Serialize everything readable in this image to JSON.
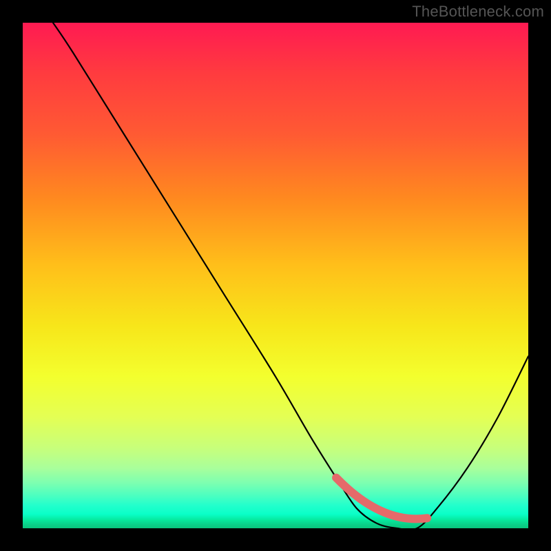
{
  "attribution": "TheBottleneck.com",
  "chart_data": {
    "type": "line",
    "title": "",
    "xlabel": "",
    "ylabel": "",
    "xlim": [
      0,
      100
    ],
    "ylim": [
      0,
      100
    ],
    "series": [
      {
        "name": "bottleneck-curve",
        "x": [
          6,
          10,
          20,
          30,
          40,
          50,
          57,
          62,
          66,
          70,
          74,
          78,
          82,
          88,
          94,
          100
        ],
        "values": [
          100,
          94,
          78,
          62,
          46,
          30,
          18,
          10,
          4,
          1,
          0,
          0,
          4,
          12,
          22,
          34
        ]
      }
    ],
    "valley_range_x": [
      62,
      80
    ],
    "grid": false,
    "legend": false,
    "colors": {
      "curve": "#000000",
      "valley_marker": "#e56a6a",
      "gradient_top": "#ff1a52",
      "gradient_bottom": "#0ac47c"
    }
  }
}
